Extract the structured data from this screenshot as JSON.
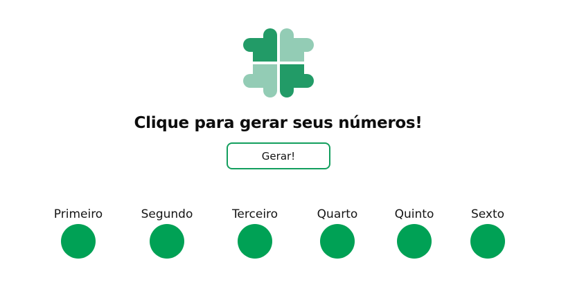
{
  "colors": {
    "leaf_dark": "#229b67",
    "leaf_light": "#93ccb5",
    "ball": "#00a155",
    "button_border": "#129e5d"
  },
  "logo": {
    "icon": "four-leaf-clover-icon"
  },
  "headline": "Clique para gerar seus números!",
  "button_label": "Gerar!",
  "slots": [
    {
      "label": "Primeiro",
      "value": ""
    },
    {
      "label": "Segundo",
      "value": ""
    },
    {
      "label": "Terceiro",
      "value": ""
    },
    {
      "label": "Quarto",
      "value": ""
    },
    {
      "label": "Quinto",
      "value": ""
    },
    {
      "label": "Sexto",
      "value": ""
    }
  ]
}
